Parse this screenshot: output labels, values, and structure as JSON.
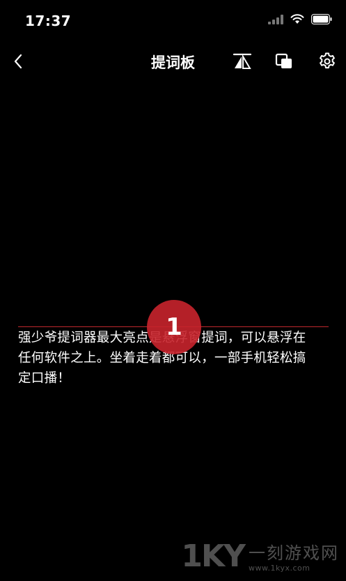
{
  "status_bar": {
    "time": "17:37"
  },
  "nav": {
    "title": "提词板"
  },
  "prompter": {
    "marker_number": "1",
    "lines": [
      "强少爷提词器最大亮点是悬浮窗提词，可以悬浮在",
      "任何软件之上。坐着走着都可以，一部手机轻松搞",
      "定口播！"
    ],
    "line_color": "#c0282d",
    "marker_color": "#c8242c"
  },
  "watermark": {
    "logo": "1KY",
    "name": "一刻游戏网",
    "url": "www.1kyx.com"
  },
  "icons": {
    "back": "chevron-left-icon",
    "mirror": "mirror-flip-icon",
    "window": "floating-window-icon",
    "settings": "gear-icon",
    "signal": "cellular-signal-icon",
    "wifi": "wifi-icon",
    "battery": "battery-icon"
  }
}
